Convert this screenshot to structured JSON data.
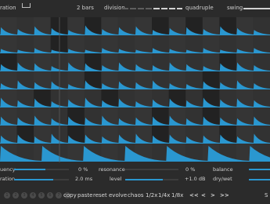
{
  "top": {
    "duration_label": "ration",
    "duration_value": "2 bars",
    "division_label": "division",
    "division_value": "quadruple",
    "swing_label": "swing"
  },
  "controls": {
    "frequency_label": "uency",
    "frequency_value": "0 %",
    "resonance_label": "resonance",
    "resonance_value": "0 %",
    "balance_label": "balance",
    "saturation_label": "ration",
    "saturation_value": "2.0 ms",
    "level_label": "level",
    "level_value": "+1.0 dB",
    "drywet_label": "dry/wet"
  },
  "bottom": {
    "pages": [
      "1",
      "2",
      "3",
      "4",
      "5",
      "6",
      "7",
      "8"
    ],
    "copy": "copy",
    "paste": "paste",
    "reset": "reset",
    "evolve": "evolve",
    "chaos": "chaos",
    "half": "1/2x",
    "quarter": "1/4x",
    "eighth": "1/8x",
    "prev_prev": "<<",
    "prev": "<",
    "next": ">",
    "next_next": ">>",
    "right_label": "S"
  },
  "colors": {
    "accent": "#2a97d0",
    "background": "#2b2b2b"
  }
}
